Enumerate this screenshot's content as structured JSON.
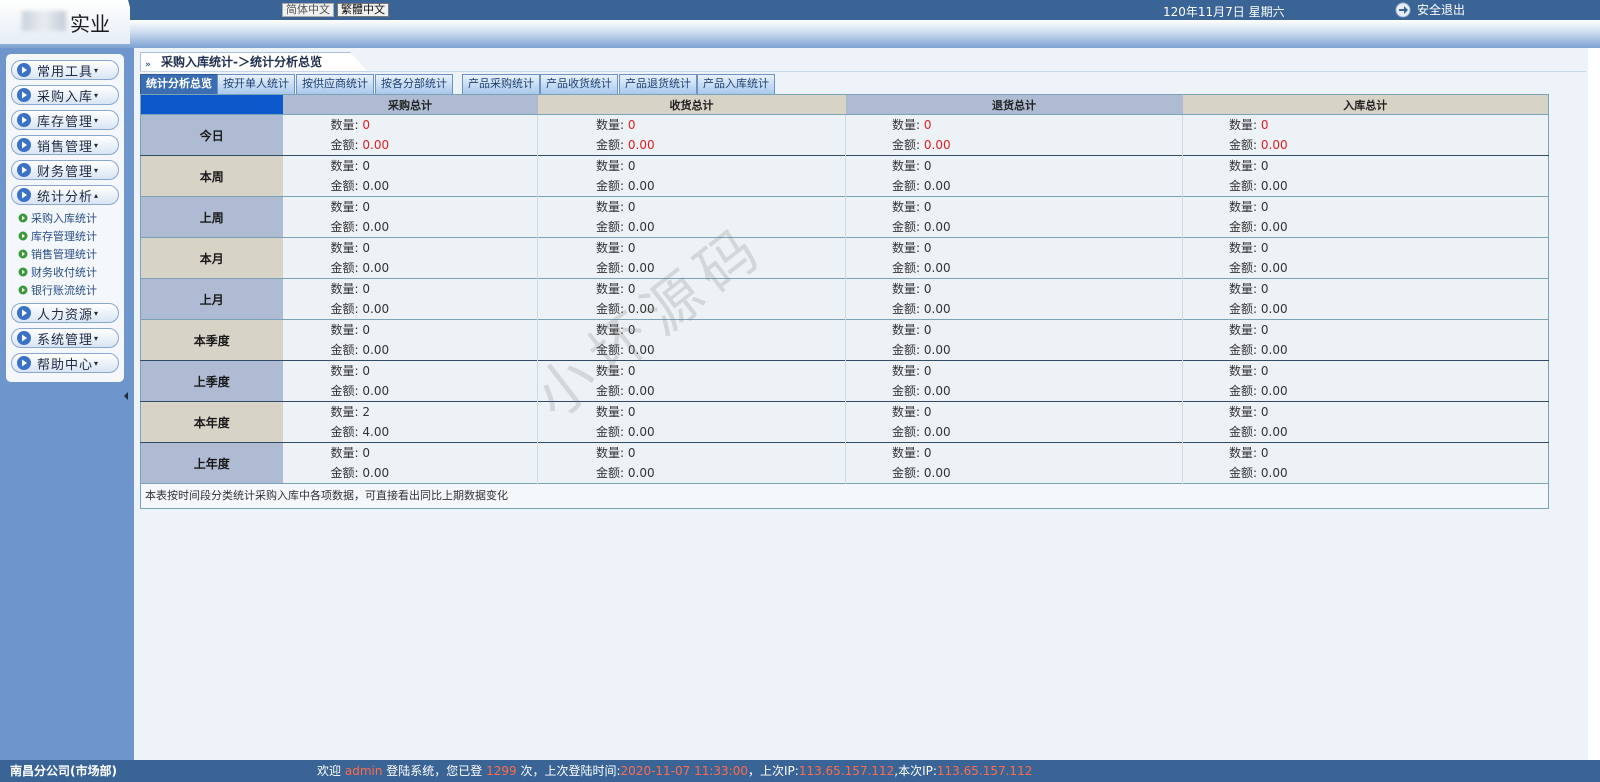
{
  "header": {
    "logo_text": "实业",
    "lang_simplified": "简体中文",
    "lang_traditional": "繁體中文",
    "date": "120年11月7日 星期六",
    "logout_label": "安全退出"
  },
  "sidebar": {
    "menus": [
      {
        "label": "常用工具",
        "caret": "▾"
      },
      {
        "label": "采购入库",
        "caret": "▾"
      },
      {
        "label": "库存管理",
        "caret": "▾"
      },
      {
        "label": "销售管理",
        "caret": "▾"
      },
      {
        "label": "财务管理",
        "caret": "▾"
      },
      {
        "label": "统计分析",
        "caret": "▴"
      },
      {
        "label": "人力资源",
        "caret": "▾"
      },
      {
        "label": "系统管理",
        "caret": "▾"
      },
      {
        "label": "帮助中心",
        "caret": "▾"
      }
    ],
    "sub_items": [
      {
        "label": "采购入库统计"
      },
      {
        "label": "库存管理统计"
      },
      {
        "label": "销售管理统计"
      },
      {
        "label": "财务收付统计"
      },
      {
        "label": "银行账流统计"
      }
    ]
  },
  "breadcrumb": "采购入库统计-＞统计分析总览",
  "tabs": [
    {
      "label": "统计分析总览",
      "active": true
    },
    {
      "label": "按开单人统计",
      "active": false
    },
    {
      "label": "按供应商统计",
      "active": false
    },
    {
      "label": "按各分部统计",
      "active": false
    },
    {
      "label": "产品采购统计",
      "active": false
    },
    {
      "label": "产品收货统计",
      "active": false
    },
    {
      "label": "产品退货统计",
      "active": false
    },
    {
      "label": "产品入库统计",
      "active": false
    }
  ],
  "table": {
    "headers": [
      "",
      "采购总计",
      "收货总计",
      "退货总计",
      "入库总计"
    ],
    "qty_label": "数量:",
    "amt_label": "金额:",
    "rows": [
      {
        "label": "今日",
        "cells": [
          [
            "0",
            "0.00"
          ],
          [
            "0",
            "0.00"
          ],
          [
            "0",
            "0.00"
          ],
          [
            "0",
            "0.00"
          ]
        ]
      },
      {
        "label": "本周",
        "cells": [
          [
            "0",
            "0.00"
          ],
          [
            "0",
            "0.00"
          ],
          [
            "0",
            "0.00"
          ],
          [
            "0",
            "0.00"
          ]
        ]
      },
      {
        "label": "上周",
        "cells": [
          [
            "0",
            "0.00"
          ],
          [
            "0",
            "0.00"
          ],
          [
            "0",
            "0.00"
          ],
          [
            "0",
            "0.00"
          ]
        ]
      },
      {
        "label": "本月",
        "cells": [
          [
            "0",
            "0.00"
          ],
          [
            "0",
            "0.00"
          ],
          [
            "0",
            "0.00"
          ],
          [
            "0",
            "0.00"
          ]
        ]
      },
      {
        "label": "上月",
        "cells": [
          [
            "0",
            "0.00"
          ],
          [
            "0",
            "0.00"
          ],
          [
            "0",
            "0.00"
          ],
          [
            "0",
            "0.00"
          ]
        ]
      },
      {
        "label": "本季度",
        "cells": [
          [
            "0",
            "0.00"
          ],
          [
            "0",
            "0.00"
          ],
          [
            "0",
            "0.00"
          ],
          [
            "0",
            "0.00"
          ]
        ]
      },
      {
        "label": "上季度",
        "cells": [
          [
            "0",
            "0.00"
          ],
          [
            "0",
            "0.00"
          ],
          [
            "0",
            "0.00"
          ],
          [
            "0",
            "0.00"
          ]
        ]
      },
      {
        "label": "本年度",
        "cells": [
          [
            "2",
            "4.00"
          ],
          [
            "0",
            "0.00"
          ],
          [
            "0",
            "0.00"
          ],
          [
            "0",
            "0.00"
          ]
        ]
      },
      {
        "label": "上年度",
        "cells": [
          [
            "0",
            "0.00"
          ],
          [
            "0",
            "0.00"
          ],
          [
            "0",
            "0.00"
          ],
          [
            "0",
            "0.00"
          ]
        ]
      }
    ],
    "note": "本表按时间段分类统计采购入库中各项数据，可直接看出同比上期数据变化"
  },
  "watermark": "小坏源码",
  "footer": {
    "org": "南昌分公司(市场部)",
    "welcome": "欢迎",
    "user": "admin",
    "login_text": "登陆系统，您已登",
    "login_count": "1299",
    "times_text": "次，上次登陆时间:",
    "last_login_time": "2020-11-07 11:33:00",
    "last_ip_label": "，上次IP:",
    "last_ip": "113.65.157.112",
    "this_ip_label": ",本次IP:",
    "this_ip": "113.65.157.112"
  },
  "colors": {
    "header_bg": "#3a6496",
    "sidebar_bg": "#6e96cc",
    "tab_active": "#3b6db2",
    "highlight_red": "#e02020"
  }
}
